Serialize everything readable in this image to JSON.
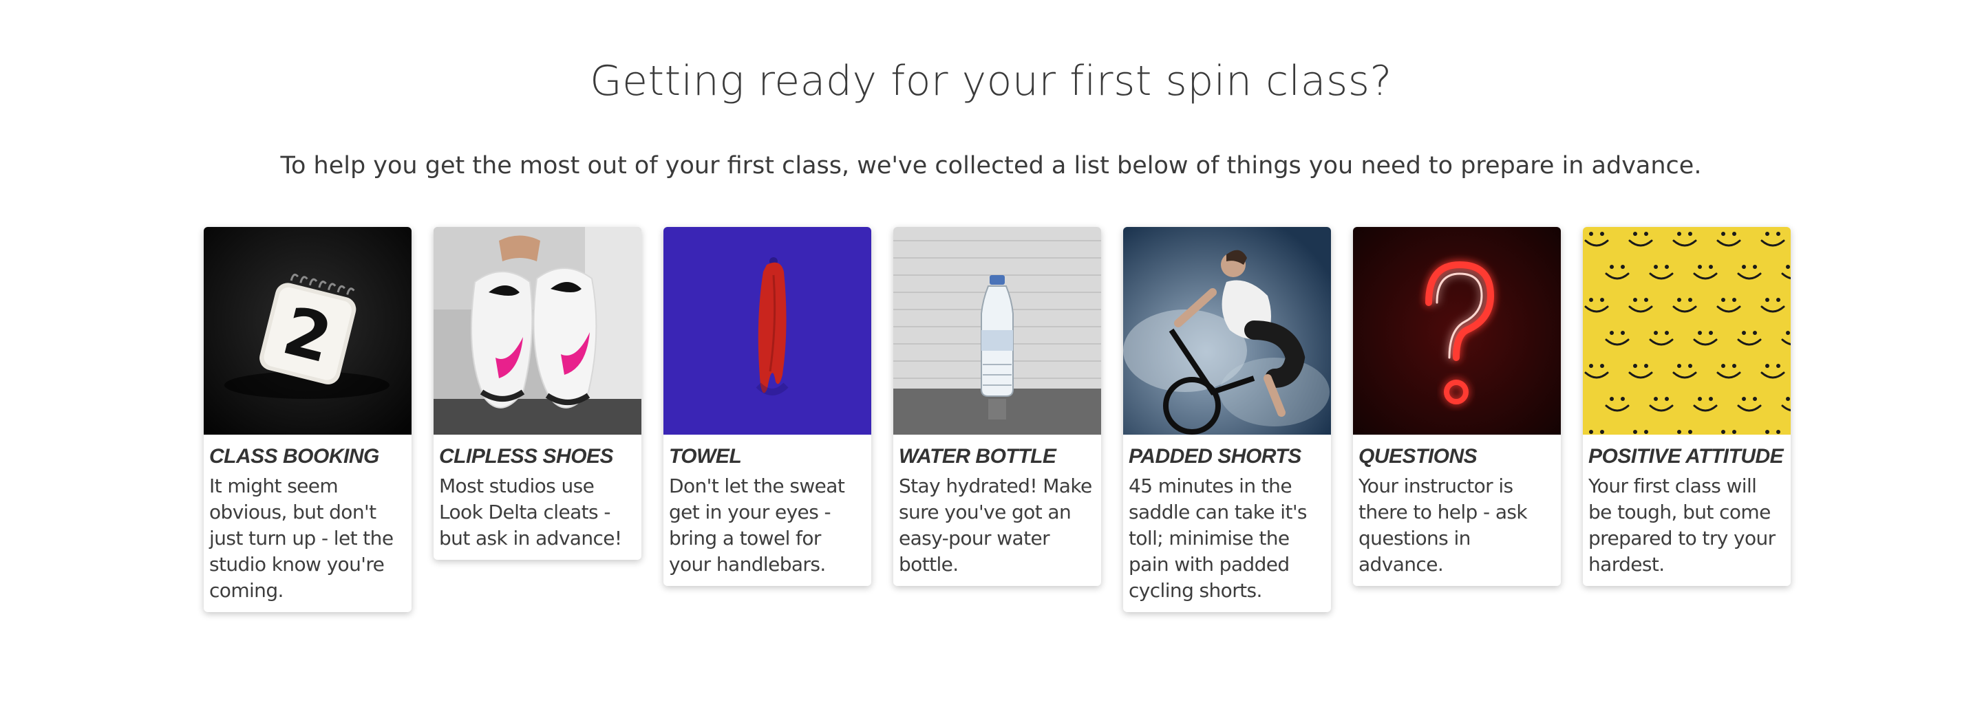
{
  "page": {
    "title": "Getting ready for your first spin class?",
    "intro": "To help you get the most out of your first class, we've collected a list below of things you need to prepare in advance."
  },
  "cards": [
    {
      "title": "CLASS BOOKING",
      "text": "It might seem obvious, but don't just turn up - let the studio know you're coming.",
      "image": "calendar-day-2-photo"
    },
    {
      "title": "CLIPLESS SHOES",
      "text": "Most studios use Look Delta cleats - but ask in advance!",
      "image": "cycling-shoes-photo"
    },
    {
      "title": "TOWEL",
      "text": "Don't let the sweat get in your eyes - bring a towel for your handlebars.",
      "image": "red-towel-photo"
    },
    {
      "title": "WATER BOTTLE",
      "text": "Stay hydrated! Make sure you've got an easy-pour water bottle.",
      "image": "water-bottle-photo"
    },
    {
      "title": "PADDED SHORTS",
      "text": "45 minutes in the saddle can take it's toll; minimise the pain with padded cycling shorts.",
      "image": "cyclist-photo"
    },
    {
      "title": "QUESTIONS",
      "text": "Your instructor is there to help - ask questions in advance.",
      "image": "neon-question-mark-photo"
    },
    {
      "title": "POSITIVE ATTITUDE",
      "text": "Your first class will be tough, but come prepared to try your hardest.",
      "image": "smiley-faces-photo"
    }
  ],
  "colors": {
    "text": "#3a3a3a",
    "card_background": "#ffffff",
    "towel_background": "#3a25b5",
    "smiley_background": "#f0d338",
    "neon_red": "#ff3b30"
  }
}
